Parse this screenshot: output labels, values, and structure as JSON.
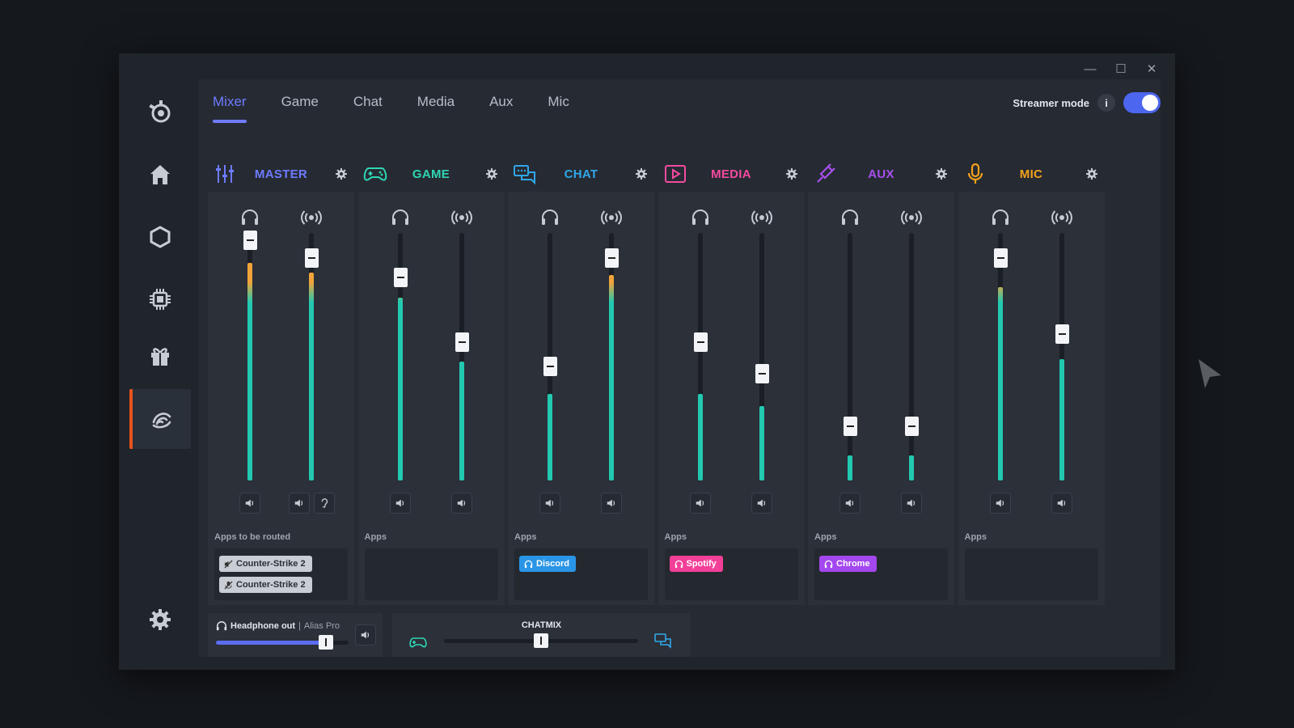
{
  "window_controls": {
    "minimize": "—",
    "maximize": "☐",
    "close": "✕"
  },
  "sidebar": {
    "items": [
      {
        "icon": "steelseries-logo-icon"
      },
      {
        "icon": "home-icon"
      },
      {
        "icon": "hexagon-icon"
      },
      {
        "icon": "chip-icon"
      },
      {
        "icon": "gift-icon"
      },
      {
        "icon": "sonar-icon",
        "active": true
      },
      {
        "icon": "gear-icon"
      }
    ]
  },
  "tabs": [
    {
      "label": "Mixer",
      "active": true
    },
    {
      "label": "Game"
    },
    {
      "label": "Chat"
    },
    {
      "label": "Media"
    },
    {
      "label": "Aux"
    },
    {
      "label": "Mic"
    }
  ],
  "streamer_mode": {
    "label": "Streamer mode",
    "info": "i",
    "enabled": true,
    "accent": "#4c66ef"
  },
  "channels": [
    {
      "key": "master",
      "name": "MASTER",
      "color": "#6e7bff",
      "icon": "sliders-icon",
      "apps_label": "Apps to be routed",
      "left": {
        "level": 0.88,
        "fader": 0.97
      },
      "right": {
        "level": 0.84,
        "fader": 0.9
      },
      "apps": [
        {
          "name": "Counter-Strike 2",
          "style": "muted-speaker"
        },
        {
          "name": "Counter-Strike 2",
          "style": "muted-mic"
        }
      ]
    },
    {
      "key": "game",
      "name": "GAME",
      "color": "#2fd6b4",
      "icon": "gamepad-icon",
      "apps_label": "Apps",
      "left": {
        "level": 0.74,
        "fader": 0.82
      },
      "right": {
        "level": 0.48,
        "fader": 0.56
      },
      "apps": []
    },
    {
      "key": "chat",
      "name": "CHAT",
      "color": "#31a7ea",
      "icon": "chat-icon",
      "apps_label": "Apps",
      "left": {
        "level": 0.35,
        "fader": 0.46
      },
      "right": {
        "level": 0.83,
        "fader": 0.9
      },
      "apps": [
        {
          "name": "Discord",
          "color": "#2a95e6"
        }
      ]
    },
    {
      "key": "media",
      "name": "MEDIA",
      "color": "#f44aa0",
      "icon": "play-icon",
      "apps_label": "Apps",
      "left": {
        "level": 0.35,
        "fader": 0.56
      },
      "right": {
        "level": 0.3,
        "fader": 0.43
      },
      "apps": [
        {
          "name": "Spotify",
          "color": "#f23f98"
        }
      ]
    },
    {
      "key": "aux",
      "name": "AUX",
      "color": "#a94ff0",
      "icon": "plug-icon",
      "apps_label": "Apps",
      "left": {
        "level": 0.1,
        "fader": 0.22
      },
      "right": {
        "level": 0.1,
        "fader": 0.22
      },
      "apps": [
        {
          "name": "Chrome",
          "color": "#a347ee"
        }
      ]
    },
    {
      "key": "mic",
      "name": "MIC",
      "color": "#f2a11b",
      "icon": "mic-icon",
      "apps_label": "Apps",
      "left": {
        "level": 0.78,
        "fader": 0.9
      },
      "right": {
        "level": 0.49,
        "fader": 0.59
      },
      "apps": []
    }
  ],
  "headphone_out": {
    "label": "Headphone out",
    "device": "Alias Pro",
    "value": 0.83
  },
  "chatmix": {
    "label": "CHATMIX",
    "value": 0.5
  },
  "meter_colors": {
    "low": "#22c9b0",
    "mid": "#f0a43a",
    "high": "#ee4d4d"
  }
}
